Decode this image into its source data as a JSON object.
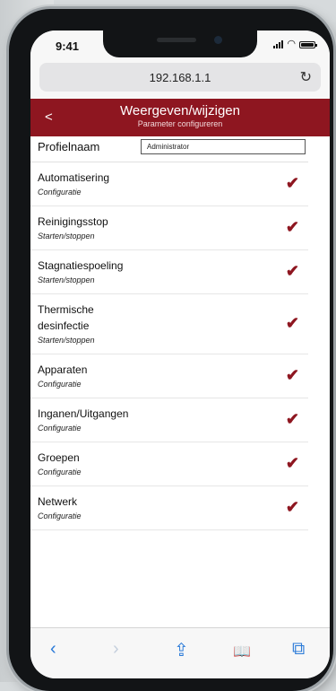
{
  "status_bar": {
    "time": "9:41"
  },
  "browser": {
    "url": "192.168.1.1"
  },
  "header": {
    "back": "<",
    "title": "Weergeven/wijzigen",
    "subtitle": "Parameter configureren"
  },
  "profile": {
    "label": "Profielnaam",
    "value": "Administrator"
  },
  "items": [
    {
      "title": "Automatisering",
      "subtitle": "Configuratie"
    },
    {
      "title": "Reinigingsstop",
      "subtitle": "Starten/stoppen"
    },
    {
      "title": "Stagnatiespoeling",
      "subtitle": "Starten/stoppen"
    },
    {
      "title": "Thermische desinfectie",
      "subtitle": "Starten/stoppen"
    },
    {
      "title": "Apparaten",
      "subtitle": "Configuratie"
    },
    {
      "title": "Inganen/Uitgangen",
      "subtitle": "Configuratie"
    },
    {
      "title": "Groepen",
      "subtitle": "Configuratie"
    },
    {
      "title": "Netwerk",
      "subtitle": "Configuratie"
    }
  ],
  "check_symbol": "✔",
  "toolbar": {
    "back": "‹",
    "forward": "›",
    "share": "⇪",
    "bookmarks": "📖",
    "tabs": "⧉"
  },
  "colors": {
    "header_bg": "#8e1620",
    "check": "#8e1620",
    "link": "#2a7ad8"
  }
}
